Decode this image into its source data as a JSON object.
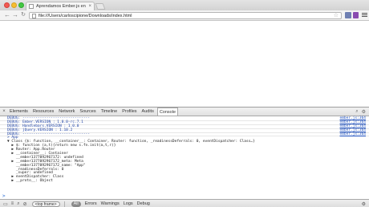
{
  "browser": {
    "tab_title": "Aprendamos Ember.js en",
    "tab_close": "×",
    "url": "file:///Users/carloscipione/Downloads/index.html",
    "nav": {
      "back": "←",
      "forward": "→",
      "reload": "↻"
    },
    "star": "☆"
  },
  "devtools": {
    "close": "×",
    "tabs": [
      "Elements",
      "Resources",
      "Network",
      "Sources",
      "Timeline",
      "Profiles",
      "Audits",
      "Console"
    ],
    "active_tab": "Console",
    "search": "⌕",
    "gear": "⚙",
    "console_lines": [
      {
        "type": "debug",
        "text": "DEBUG: -------------------------------",
        "src": "ember.js:364"
      },
      {
        "type": "debug",
        "text": "DEBUG: Ember.VERSION : 1.0.0-rc.7.1",
        "src": "ember.js:364"
      },
      {
        "type": "debug",
        "text": "DEBUG: Handlebars.VERSION : 1.0.0",
        "src": "ember.js:364"
      },
      {
        "type": "debug",
        "text": "DEBUG: jQuery.VERSION : 1.10.2",
        "src": "ember.js:364"
      },
      {
        "type": "debug",
        "text": "DEBUG: -------------------------------",
        "src": "ember.js:364"
      },
      {
        "type": "input",
        "text": "> App"
      },
      {
        "type": "obj",
        "text": "▼ Class {$: function, __container__: Container, Router: function, _readinessDeferrals: 0, eventDispatcher: Class…}"
      },
      {
        "type": "obj",
        "text": "  ▶ $: function (a,t){return new s.fn.init(a,t,r)}"
      },
      {
        "type": "obj",
        "text": "  ▶ Router: App.Router"
      },
      {
        "type": "obj",
        "text": "  ▶ __container__: Container"
      },
      {
        "type": "obj",
        "text": "    __ember1377092967172: undefined"
      },
      {
        "type": "obj",
        "text": "  ▶ __ember1377092967172_meta: Meta"
      },
      {
        "type": "obj",
        "text": "    __ember1377092967172_name: \"App\""
      },
      {
        "type": "obj",
        "text": "    _readinessDeferrals: 0"
      },
      {
        "type": "obj",
        "text": "    _super: undefined"
      },
      {
        "type": "obj",
        "text": "  ▶ eventDispatcher: Class"
      },
      {
        "type": "obj",
        "text": "  ▶ __proto__: Object"
      }
    ],
    "prompt": ">",
    "bottom": {
      "frame": "<top frame>",
      "filters": [
        "All",
        "Errors",
        "Warnings",
        "Logs",
        "Debug"
      ],
      "active_filter": "All"
    }
  }
}
